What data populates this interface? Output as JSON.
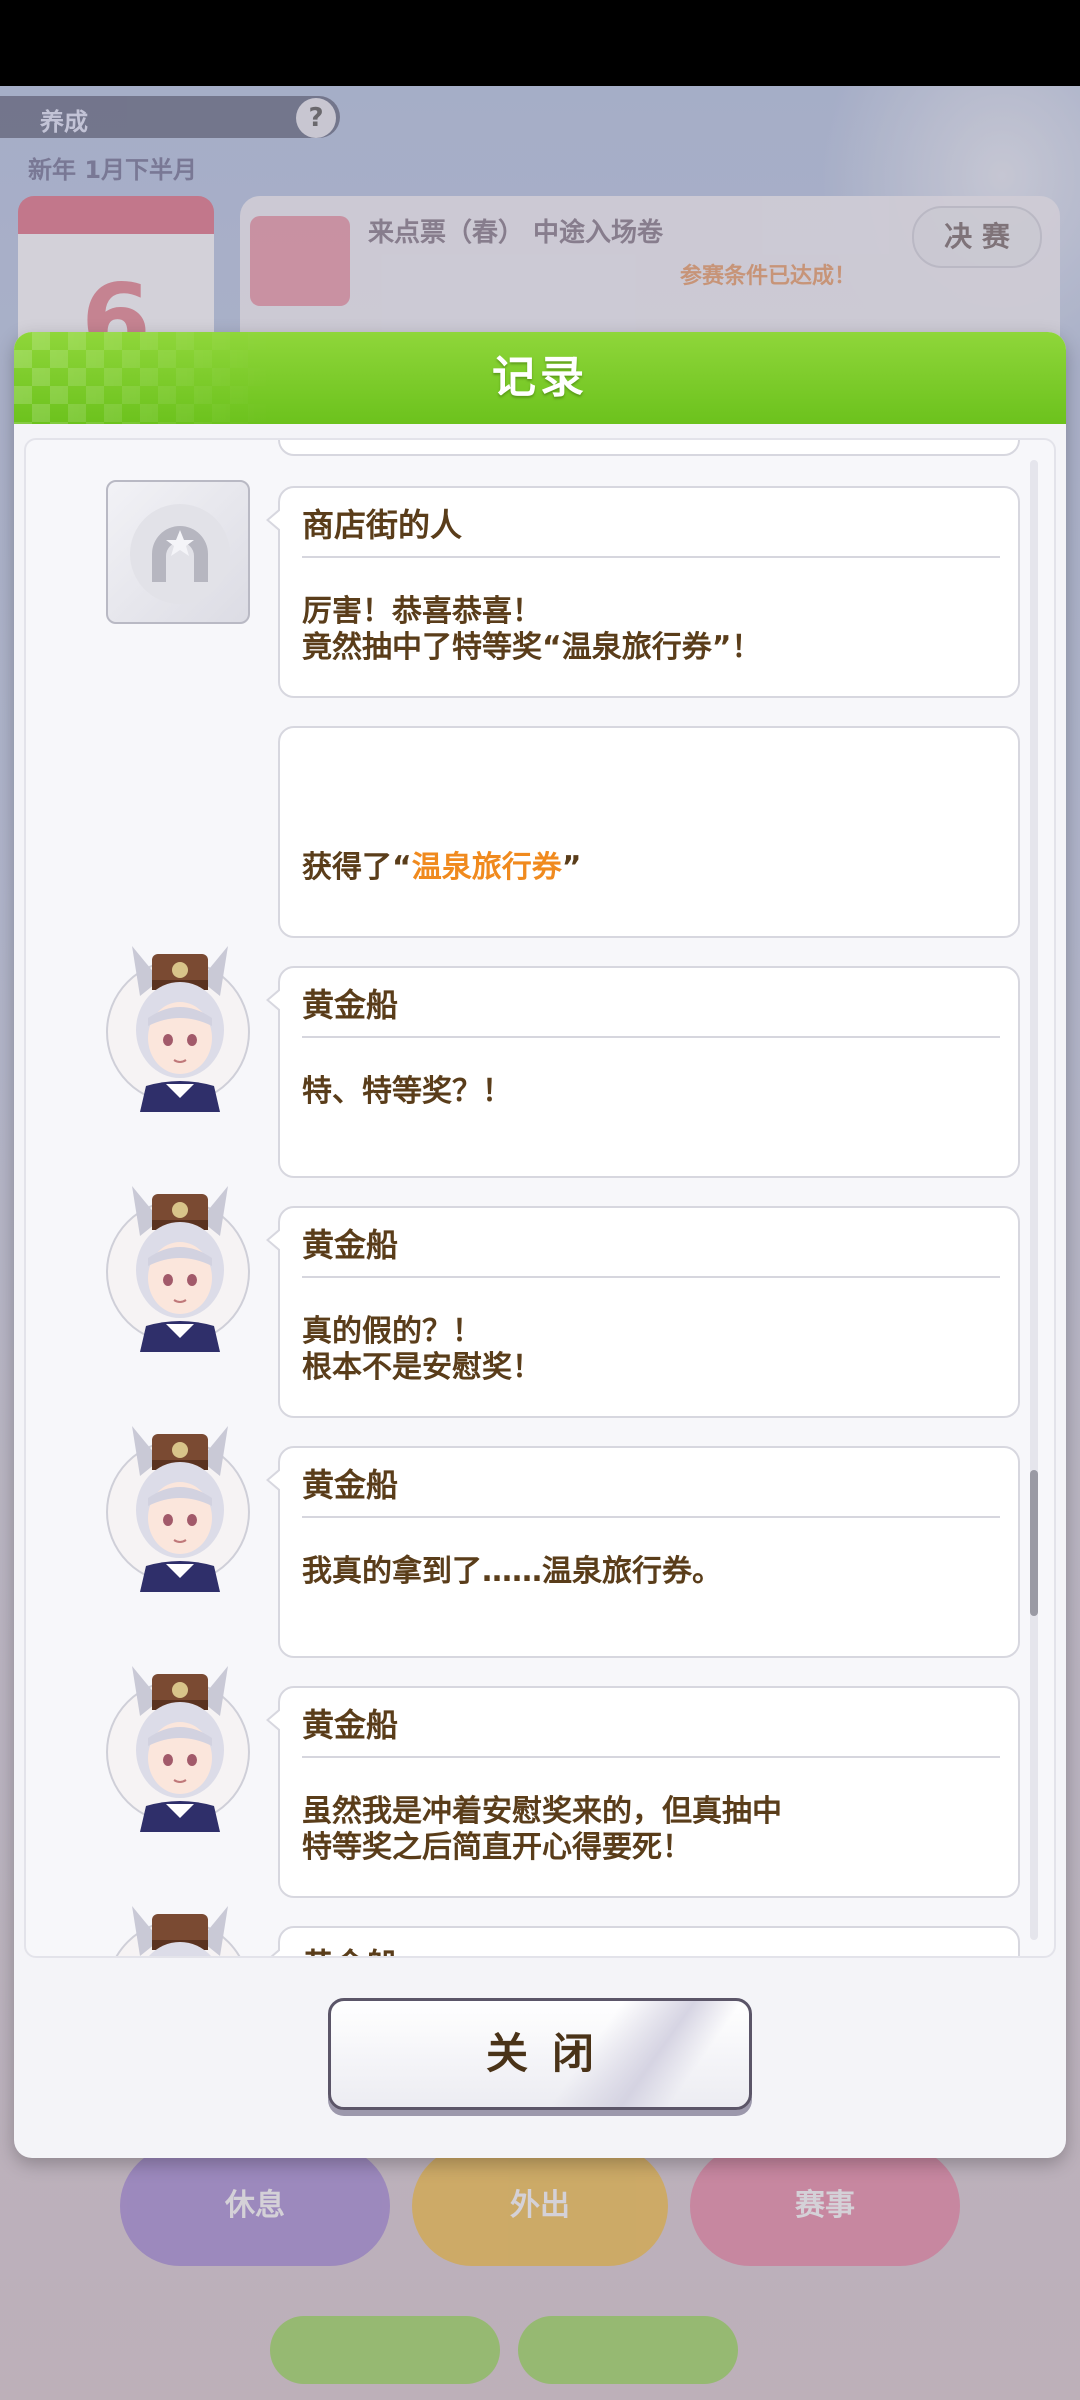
{
  "background": {
    "topbar_label": "养成",
    "help_icon": "question-icon",
    "subtitle": "新年 1月下半月",
    "calendar_number": "6",
    "card_title": "来点票（春） 中途入场卷",
    "card_note": "参赛条件已达成！",
    "card_button": "决 赛",
    "bottom_left_label": "休息",
    "bottom_mid_label": "外出",
    "bottom_right_label": "赛事"
  },
  "dialog": {
    "title": "记录",
    "header_color": "#79c927",
    "entries": [
      {
        "speaker": "商店街的人",
        "lines": "厉害！恭喜恭喜！\n竟然抽中了特等奖“温泉旅行券”！",
        "avatar": "horseshoe-placeholder-icon"
      },
      {
        "prefix": "获得了“",
        "highlight": "温泉旅行券",
        "suffix": "”",
        "highlight_color": "#f08a1e"
      },
      {
        "speaker": "黄金船",
        "lines": "特、特等奖？！",
        "avatar": "gold-ship-portrait"
      },
      {
        "speaker": "黄金船",
        "lines": "真的假的？！\n根本不是安慰奖！",
        "avatar": "gold-ship-portrait"
      },
      {
        "speaker": "黄金船",
        "lines": "我真的拿到了……温泉旅行券。",
        "avatar": "gold-ship-portrait"
      },
      {
        "speaker": "黄金船",
        "lines": "虽然我是冲着安慰奖来的，但真抽中\n特等奖之后简直开心得要死！",
        "avatar": "gold-ship-portrait"
      },
      {
        "speaker": "黄金船",
        "avatar": "gold-ship-portrait"
      }
    ],
    "close_label": "关闭"
  }
}
